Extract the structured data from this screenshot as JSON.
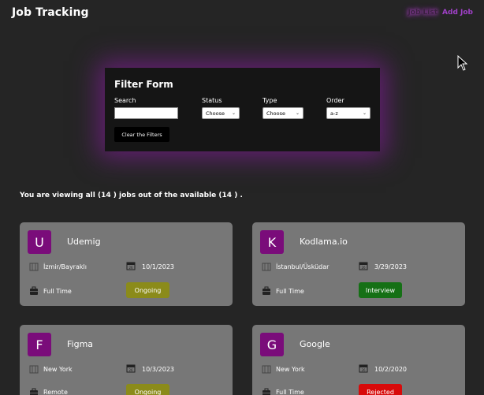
{
  "header": {
    "title": "Job Tracking",
    "nav": {
      "jobs_label": "Job List",
      "add_label": "Add Job"
    }
  },
  "filter": {
    "title": "Filter Form",
    "search_label": "Search",
    "search_value": "",
    "status_label": "Status",
    "status_value": "Choose",
    "type_label": "Type",
    "type_value": "Choose",
    "order_label": "Order",
    "order_value": "a-z",
    "clear_label": "Clear the Filters"
  },
  "summary": "You are viewing all (14 ) jobs out of the available (14 ) .",
  "colors": {
    "ongoing": "#8b8b1a",
    "interview": "#157015",
    "rejected": "#d80a0a",
    "logo": "#7a0c7a",
    "nav_accent": "#a040c8"
  },
  "jobs": [
    {
      "letter": "U",
      "company": "Udemig",
      "location": "İzmir/Bayraklı",
      "date": "10/1/2023",
      "type": "Full Time",
      "status": "Ongoing"
    },
    {
      "letter": "K",
      "company": "Kodlama.io",
      "location": "İstanbul/Üsküdar",
      "date": "3/29/2023",
      "type": "Full Time",
      "status": "Interview"
    },
    {
      "letter": "F",
      "company": "Figma",
      "location": "New York",
      "date": "10/3/2023",
      "type": "Remote",
      "status": "Ongoing"
    },
    {
      "letter": "G",
      "company": "Google",
      "location": "New York",
      "date": "10/2/2020",
      "type": "Full Time",
      "status": "Rejected"
    }
  ]
}
